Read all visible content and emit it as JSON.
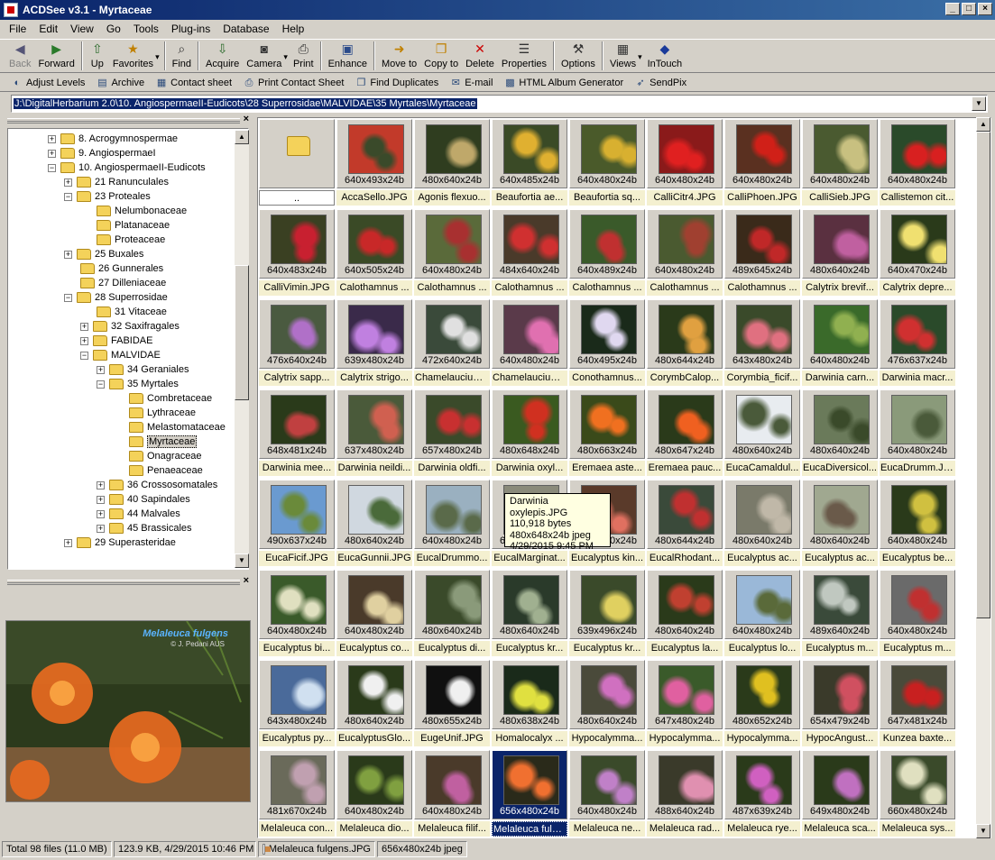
{
  "window": {
    "title": "ACDSee v3.1 - Myrtaceae"
  },
  "menu": [
    "File",
    "Edit",
    "View",
    "Go",
    "Tools",
    "Plug-ins",
    "Database",
    "Help"
  ],
  "toolbar": [
    {
      "label": "Back",
      "icon": "back-icon",
      "glyph": "◀",
      "disabled": true
    },
    {
      "label": "Forward",
      "icon": "forward-icon",
      "glyph": "▶"
    },
    {
      "label": "Up",
      "icon": "up-folder-icon",
      "glyph": "⇧"
    },
    {
      "label": "Favorites",
      "icon": "favorites-icon",
      "glyph": "★",
      "dropdown": true
    },
    {
      "label": "Find",
      "icon": "binoculars-icon",
      "glyph": "⌕"
    },
    {
      "label": "Acquire",
      "icon": "acquire-icon",
      "glyph": "⇩"
    },
    {
      "label": "Camera",
      "icon": "camera-icon",
      "glyph": "◙",
      "dropdown": true
    },
    {
      "label": "Print",
      "icon": "printer-icon",
      "glyph": "⎙"
    },
    {
      "label": "Enhance",
      "icon": "enhance-icon",
      "glyph": "▣"
    },
    {
      "label": "Move to",
      "icon": "move-to-icon",
      "glyph": "➜"
    },
    {
      "label": "Copy to",
      "icon": "copy-to-icon",
      "glyph": "❐"
    },
    {
      "label": "Delete",
      "icon": "delete-icon",
      "glyph": "✕"
    },
    {
      "label": "Properties",
      "icon": "properties-icon",
      "glyph": "☰"
    },
    {
      "label": "Options",
      "icon": "options-icon",
      "glyph": "⚒"
    },
    {
      "label": "Views",
      "icon": "views-icon",
      "glyph": "▦",
      "dropdown": true
    },
    {
      "label": "InTouch",
      "icon": "intouch-icon",
      "glyph": "◆"
    }
  ],
  "toolbar2": [
    {
      "label": "Adjust Levels",
      "icon": "adjust-levels-icon",
      "glyph": "◐"
    },
    {
      "label": "Archive",
      "icon": "archive-icon",
      "glyph": "▤"
    },
    {
      "label": "Contact sheet",
      "icon": "contact-sheet-icon",
      "glyph": "▦"
    },
    {
      "label": "Print Contact Sheet",
      "icon": "print-contact-sheet-icon",
      "glyph": "⎙"
    },
    {
      "label": "Find Duplicates",
      "icon": "find-duplicates-icon",
      "glyph": "❐"
    },
    {
      "label": "E-mail",
      "icon": "email-icon",
      "glyph": "✉"
    },
    {
      "label": "HTML Album Generator",
      "icon": "html-album-icon",
      "glyph": "▩"
    },
    {
      "label": "SendPix",
      "icon": "sendpix-icon",
      "glyph": "➶"
    }
  ],
  "address": "J:\\DigitalHerbarium 2.0\\10. AngiospermaeII-Eudicots\\28 Superrosidae\\MALVIDAE\\35 Myrtales\\Myrtaceae",
  "tree": [
    {
      "label": "8. Acrogymnospermae",
      "level": 0,
      "pm": "+"
    },
    {
      "label": "9. AngiospermaeI",
      "level": 0,
      "pm": "+"
    },
    {
      "label": "10. AngiospermaeII-Eudicots",
      "level": 0,
      "pm": "−"
    },
    {
      "label": "21 Ranunculales",
      "level": 1,
      "pm": "+"
    },
    {
      "label": "23 Proteales",
      "level": 1,
      "pm": "−"
    },
    {
      "label": "Nelumbonaceae",
      "level": 2,
      "pm": ""
    },
    {
      "label": "Platanaceae",
      "level": 2,
      "pm": ""
    },
    {
      "label": "Proteaceae",
      "level": 2,
      "pm": ""
    },
    {
      "label": "25 Buxales",
      "level": 1,
      "pm": "+"
    },
    {
      "label": "26 Gunnerales",
      "level": 1,
      "pm": ""
    },
    {
      "label": "27 Dilleniaceae",
      "level": 1,
      "pm": ""
    },
    {
      "label": "28 Superrosidae",
      "level": 1,
      "pm": "−"
    },
    {
      "label": "31 Vitaceae",
      "level": 2,
      "pm": ""
    },
    {
      "label": "32 Saxifragales",
      "level": 2,
      "pm": "+"
    },
    {
      "label": "FABIDAE",
      "level": 2,
      "pm": "+"
    },
    {
      "label": "MALVIDAE",
      "level": 2,
      "pm": "−"
    },
    {
      "label": "34 Geraniales",
      "level": 3,
      "pm": "+"
    },
    {
      "label": "35 Myrtales",
      "level": 3,
      "pm": "−"
    },
    {
      "label": "Combretaceae",
      "level": 4,
      "pm": ""
    },
    {
      "label": "Lythraceae",
      "level": 4,
      "pm": ""
    },
    {
      "label": "Melastomataceae",
      "level": 4,
      "pm": ""
    },
    {
      "label": "Myrtaceae",
      "level": 4,
      "pm": "",
      "selected": true
    },
    {
      "label": "Onagraceae",
      "level": 4,
      "pm": ""
    },
    {
      "label": "Penaeaceae",
      "level": 4,
      "pm": ""
    },
    {
      "label": "36 Crossosomatales",
      "level": 3,
      "pm": "+"
    },
    {
      "label": "40 Sapindales",
      "level": 3,
      "pm": "+"
    },
    {
      "label": "44 Malvales",
      "level": 3,
      "pm": "+"
    },
    {
      "label": "45 Brassicales",
      "level": 3,
      "pm": "+"
    },
    {
      "label": "29 Superasteridae",
      "level": 1,
      "pm": "+"
    }
  ],
  "preview": {
    "caption": "Melaleuca fulgens",
    "credit": "© J. Pedani AUS"
  },
  "files": [
    {
      "name": "..",
      "dims": "",
      "updir": true
    },
    {
      "name": "AccaSello.JPG",
      "dims": "640x493x24b",
      "c1": "#c23a2a",
      "c2": "#3a4a2a"
    },
    {
      "name": "Agonis flexuo...",
      "dims": "480x640x24b",
      "c1": "#2f3d1f",
      "c2": "#bfa86a"
    },
    {
      "name": "Beaufortia ae...",
      "dims": "640x485x24b",
      "c1": "#3a4a26",
      "c2": "#e0b030"
    },
    {
      "name": "Beaufortia sq...",
      "dims": "640x480x24b",
      "c1": "#4a5a2a",
      "c2": "#d8b030"
    },
    {
      "name": "CalliCitr4.JPG",
      "dims": "640x480x24b",
      "c1": "#8a1a1a",
      "c2": "#e02020"
    },
    {
      "name": "CalliPhoen.JPG",
      "dims": "640x480x24b",
      "c1": "#5a3020",
      "c2": "#d02018"
    },
    {
      "name": "CalliSieb.JPG",
      "dims": "640x480x24b",
      "c1": "#4a5a30",
      "c2": "#c8c080"
    },
    {
      "name": "Callistemon cit...",
      "dims": "640x480x24b",
      "c1": "#2a4a2a",
      "c2": "#d82020"
    },
    {
      "name": "CalliVimin.JPG",
      "dims": "640x483x24b",
      "c1": "#3a4022",
      "c2": "#c82030"
    },
    {
      "name": "Calothamnus ...",
      "dims": "640x505x24b",
      "c1": "#3a4a26",
      "c2": "#c82828"
    },
    {
      "name": "Calothamnus ...",
      "dims": "640x480x24b",
      "c1": "#5a6a3a",
      "c2": "#a83030"
    },
    {
      "name": "Calothamnus ...",
      "dims": "484x640x24b",
      "c1": "#4a3a2a",
      "c2": "#d03030"
    },
    {
      "name": "Calothamnus ...",
      "dims": "640x489x24b",
      "c1": "#3a5a2a",
      "c2": "#c03030"
    },
    {
      "name": "Calothamnus ...",
      "dims": "640x480x24b",
      "c1": "#4a5a30",
      "c2": "#a04030"
    },
    {
      "name": "Calothamnus ...",
      "dims": "489x645x24b",
      "c1": "#3a2a1a",
      "c2": "#c02828"
    },
    {
      "name": "Calytrix brevif...",
      "dims": "480x640x24b",
      "c1": "#5a3040",
      "c2": "#c060a0"
    },
    {
      "name": "Calytrix depre...",
      "dims": "640x470x24b",
      "c1": "#2a3a1a",
      "c2": "#f0e070"
    },
    {
      "name": "Calytrix sapp...",
      "dims": "476x640x24b",
      "c1": "#4a5a40",
      "c2": "#b070c8"
    },
    {
      "name": "Calytrix strigo...",
      "dims": "639x480x24b",
      "c1": "#3a2a4a",
      "c2": "#c080e0"
    },
    {
      "name": "Chamelaucium...",
      "dims": "472x640x24b",
      "c1": "#3a4a3a",
      "c2": "#e0e0e0"
    },
    {
      "name": "Chamelaucium...",
      "dims": "640x480x24b",
      "c1": "#5a3a4a",
      "c2": "#e070b0"
    },
    {
      "name": "Conothamnus...",
      "dims": "640x495x24b",
      "c1": "#1a2a1a",
      "c2": "#e0d8f0"
    },
    {
      "name": "CorymbCalop...",
      "dims": "480x644x24b",
      "c1": "#2a3a1a",
      "c2": "#e0a040"
    },
    {
      "name": "Corymbia_ficif...",
      "dims": "643x480x24b",
      "c1": "#3a4a2a",
      "c2": "#e07080"
    },
    {
      "name": "Darwinia carn...",
      "dims": "640x480x24b",
      "c1": "#3a6a2a",
      "c2": "#90b050"
    },
    {
      "name": "Darwinia macr...",
      "dims": "476x637x24b",
      "c1": "#2a4a2a",
      "c2": "#d03030"
    },
    {
      "name": "Darwinia mee...",
      "dims": "648x481x24b",
      "c1": "#2a3a1a",
      "c2": "#c04040"
    },
    {
      "name": "Darwinia neildi...",
      "dims": "637x480x24b",
      "c1": "#4a5a3a",
      "c2": "#d06050"
    },
    {
      "name": "Darwinia oldfi...",
      "dims": "657x480x24b",
      "c1": "#3a4a2a",
      "c2": "#c83030"
    },
    {
      "name": "Darwinia oxyl...",
      "dims": "480x648x24b",
      "c1": "#3a5a20",
      "c2": "#d03020"
    },
    {
      "name": "Eremaea aste...",
      "dims": "480x663x24b",
      "c1": "#3a4a1a",
      "c2": "#f07020"
    },
    {
      "name": "Eremaea pauc...",
      "dims": "480x647x24b",
      "c1": "#2a3a1a",
      "c2": "#f06020"
    },
    {
      "name": "EucaCamaldul...",
      "dims": "480x640x24b",
      "c1": "#e8ecf0",
      "c2": "#4a5a3a"
    },
    {
      "name": "EucaDiversicol...",
      "dims": "480x640x24b",
      "c1": "#6a7a5a",
      "c2": "#3a4a2a"
    },
    {
      "name": "EucaDrumm.JPG",
      "dims": "640x480x24b",
      "c1": "#8a9a7a",
      "c2": "#4a5a3a"
    },
    {
      "name": "EucaFicif.JPG",
      "dims": "490x637x24b",
      "c1": "#6a9ad0",
      "c2": "#6a8a3a"
    },
    {
      "name": "EucaGunnii.JPG",
      "dims": "480x640x24b",
      "c1": "#d0d8e0",
      "c2": "#4a6a3a"
    },
    {
      "name": "EucalDrummo...",
      "dims": "640x480x24b",
      "c1": "#9ab0c0",
      "c2": "#5a6a4a"
    },
    {
      "name": "EucalMarginat...",
      "dims": "640x480x24b",
      "c1": "#8a8a7a",
      "c2": "#5a5a4a"
    },
    {
      "name": "Eucalyptus kin...",
      "dims": "640x480x24b",
      "c1": "#5a3a2a",
      "c2": "#e07060"
    },
    {
      "name": "EucalRhodant...",
      "dims": "480x644x24b",
      "c1": "#3a4a3a",
      "c2": "#c03030"
    },
    {
      "name": "Eucalyptus ac...",
      "dims": "480x640x24b",
      "c1": "#7a7a6a",
      "c2": "#c0b8a8"
    },
    {
      "name": "Eucalyptus ac...",
      "dims": "480x640x24b",
      "c1": "#a0a890",
      "c2": "#6a5a4a"
    },
    {
      "name": "Eucalyptus be...",
      "dims": "640x480x24b",
      "c1": "#2a3a1a",
      "c2": "#d0c040"
    },
    {
      "name": "Eucalyptus bi...",
      "dims": "640x480x24b",
      "c1": "#3a5a2a",
      "c2": "#e0e0c0"
    },
    {
      "name": "Eucalyptus co...",
      "dims": "640x480x24b",
      "c1": "#4a3a2a",
      "c2": "#e0d0a0"
    },
    {
      "name": "Eucalyptus di...",
      "dims": "480x640x24b",
      "c1": "#3a4a2a",
      "c2": "#8a9a7a"
    },
    {
      "name": "Eucalyptus kr...",
      "dims": "480x640x24b",
      "c1": "#2a3a2a",
      "c2": "#a0b090"
    },
    {
      "name": "Eucalyptus kr...",
      "dims": "639x496x24b",
      "c1": "#3a4a2a",
      "c2": "#e0d060"
    },
    {
      "name": "Eucalyptus la...",
      "dims": "480x640x24b",
      "c1": "#2a3a1a",
      "c2": "#c04030"
    },
    {
      "name": "Eucalyptus lo...",
      "dims": "640x480x24b",
      "c1": "#9ab8d8",
      "c2": "#5a6a3a"
    },
    {
      "name": "Eucalyptus m...",
      "dims": "489x640x24b",
      "c1": "#3a4a3a",
      "c2": "#c0c8c0"
    },
    {
      "name": "Eucalyptus m...",
      "dims": "640x480x24b",
      "c1": "#6a6a6a",
      "c2": "#c03030"
    },
    {
      "name": "Eucalyptus py...",
      "dims": "643x480x24b",
      "c1": "#4a6a9a",
      "c2": "#d0e0f0"
    },
    {
      "name": "EucalyptusGlo...",
      "dims": "480x640x24b",
      "c1": "#2a3a1a",
      "c2": "#f0f0f0"
    },
    {
      "name": "EugeUnif.JPG",
      "dims": "480x655x24b",
      "c1": "#101010",
      "c2": "#f0f0f0"
    },
    {
      "name": "Homalocalyx ...",
      "dims": "480x638x24b",
      "c1": "#1a2a1a",
      "c2": "#e0e040"
    },
    {
      "name": "Hypocalymma...",
      "dims": "480x640x24b",
      "c1": "#4a4a3a",
      "c2": "#d070c0"
    },
    {
      "name": "Hypocalymma...",
      "dims": "647x480x24b",
      "c1": "#3a5a2a",
      "c2": "#e060a0"
    },
    {
      "name": "Hypocalymma...",
      "dims": "480x652x24b",
      "c1": "#2a3a1a",
      "c2": "#e0c020"
    },
    {
      "name": "HypocAngust...",
      "dims": "654x479x24b",
      "c1": "#3a3a2a",
      "c2": "#d05060"
    },
    {
      "name": "Kunzea baxte...",
      "dims": "647x481x24b",
      "c1": "#4a4a3a",
      "c2": "#c82020"
    },
    {
      "name": "Melaleuca con...",
      "dims": "481x670x24b",
      "c1": "#6a6a5a",
      "c2": "#c0a0b0"
    },
    {
      "name": "Melaleuca dio...",
      "dims": "640x480x24b",
      "c1": "#2a3a1a",
      "c2": "#80a040"
    },
    {
      "name": "Melaleuca filif...",
      "dims": "640x480x24b",
      "c1": "#4a3a2a",
      "c2": "#c060a0"
    },
    {
      "name": "Melaleuca fulg...",
      "dims": "656x480x24b",
      "c1": "#2a2a1a",
      "c2": "#f07030",
      "selected": true
    },
    {
      "name": "Melaleuca ne...",
      "dims": "640x480x24b",
      "c1": "#3a4a2a",
      "c2": "#c080c8"
    },
    {
      "name": "Melaleuca rad...",
      "dims": "488x640x24b",
      "c1": "#3a3a2a",
      "c2": "#e090b0"
    },
    {
      "name": "Melaleuca rye...",
      "dims": "487x639x24b",
      "c1": "#2a3a1a",
      "c2": "#d060c0"
    },
    {
      "name": "Melaleuca sca...",
      "dims": "649x480x24b",
      "c1": "#2a3a1a",
      "c2": "#c070c0"
    },
    {
      "name": "Melaleuca sys...",
      "dims": "660x480x24b",
      "c1": "#3a4a2a",
      "c2": "#e0e0c0"
    }
  ],
  "tooltip": [
    "Darwinia oxylepis.JPG",
    "110,918 bytes",
    "480x648x24b jpeg",
    "4/29/2015 9:45 PM"
  ],
  "status": {
    "total": "Total 98 files (11.0 MB)",
    "selinfo": "123.9 KB, 4/29/2015 10:46 PM",
    "filename": "Melaleuca fulgens.JPG",
    "fileinfo": "656x480x24b jpeg"
  }
}
